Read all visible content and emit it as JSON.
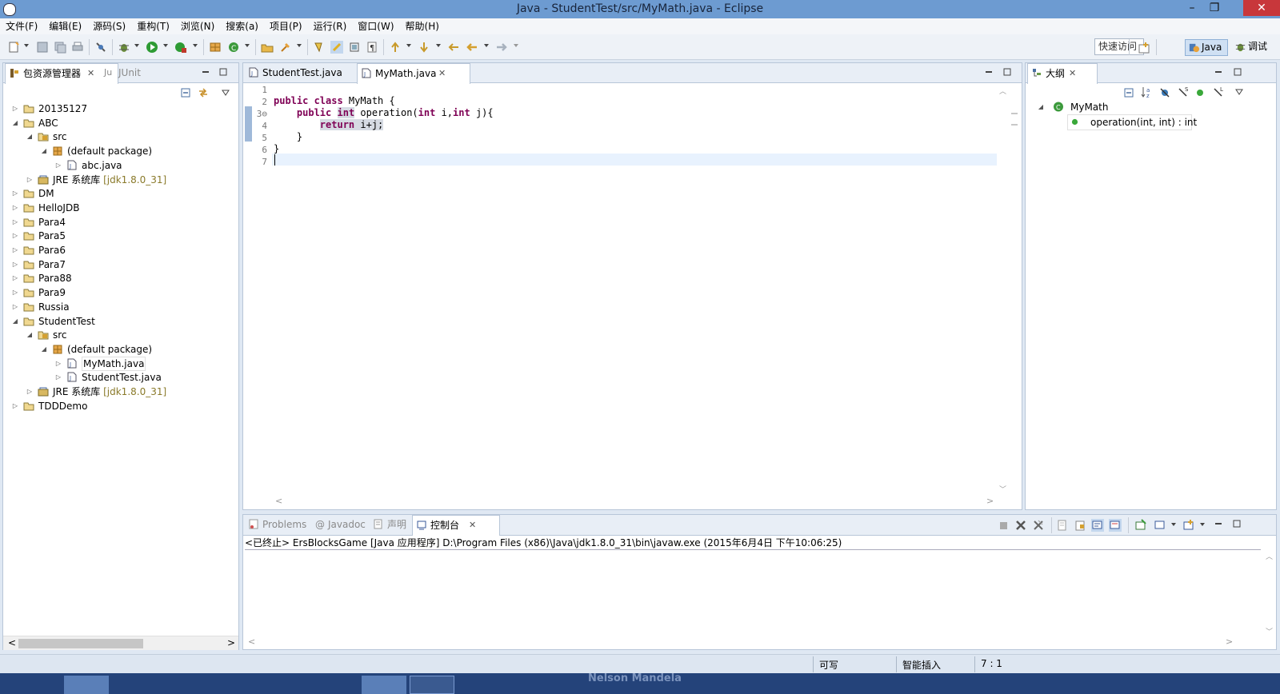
{
  "window": {
    "title": "Java - StudentTest/src/MyMath.java - Eclipse"
  },
  "menu": [
    "文件(F)",
    "编辑(E)",
    "源码(S)",
    "重构(T)",
    "浏览(N)",
    "搜索(a)",
    "项目(P)",
    "运行(R)",
    "窗口(W)",
    "帮助(H)"
  ],
  "toolbar": {
    "quick_access": "快速访问",
    "perspective_java": "Java",
    "perspective_debug": "调试"
  },
  "package_explorer": {
    "tab_label": "包资源管理器",
    "tab_junit": "JUnit",
    "tree": [
      {
        "label": "20135127",
        "depth": 0,
        "expanded": false,
        "icon": "project-icon"
      },
      {
        "label": "ABC",
        "depth": 0,
        "expanded": true,
        "icon": "project-icon"
      },
      {
        "label": "src",
        "depth": 1,
        "expanded": true,
        "icon": "source-folder-icon"
      },
      {
        "label": "(default package)",
        "depth": 2,
        "expanded": true,
        "icon": "package-icon"
      },
      {
        "label": "abc.java",
        "depth": 3,
        "expanded": false,
        "icon": "java-file-icon"
      },
      {
        "label": "JRE 系统库",
        "deco": "[jdk1.8.0_31]",
        "depth": 1,
        "expanded": false,
        "icon": "library-icon"
      },
      {
        "label": "DM",
        "depth": 0,
        "expanded": false,
        "icon": "project-icon"
      },
      {
        "label": "HelloJDB",
        "depth": 0,
        "expanded": false,
        "icon": "project-icon"
      },
      {
        "label": "Para4",
        "depth": 0,
        "expanded": false,
        "icon": "project-icon"
      },
      {
        "label": "Para5",
        "depth": 0,
        "expanded": false,
        "icon": "project-icon"
      },
      {
        "label": "Para6",
        "depth": 0,
        "expanded": false,
        "icon": "project-icon"
      },
      {
        "label": "Para7",
        "depth": 0,
        "expanded": false,
        "icon": "project-icon"
      },
      {
        "label": "Para88",
        "depth": 0,
        "expanded": false,
        "icon": "project-icon"
      },
      {
        "label": "Para9",
        "depth": 0,
        "expanded": false,
        "icon": "project-icon"
      },
      {
        "label": "Russia",
        "depth": 0,
        "expanded": false,
        "icon": "project-icon"
      },
      {
        "label": "StudentTest",
        "depth": 0,
        "expanded": true,
        "icon": "project-icon"
      },
      {
        "label": "src",
        "depth": 1,
        "expanded": true,
        "icon": "source-folder-icon"
      },
      {
        "label": "(default package)",
        "depth": 2,
        "expanded": true,
        "icon": "package-icon"
      },
      {
        "label": "MyMath.java",
        "depth": 3,
        "expanded": false,
        "icon": "java-file-icon",
        "selected": true
      },
      {
        "label": "StudentTest.java",
        "depth": 3,
        "expanded": false,
        "icon": "java-file-icon"
      },
      {
        "label": "JRE 系统库",
        "deco": "[jdk1.8.0_31]",
        "depth": 1,
        "expanded": false,
        "icon": "library-icon"
      },
      {
        "label": "TDDDemo",
        "depth": 0,
        "expanded": false,
        "icon": "project-icon"
      }
    ]
  },
  "editor": {
    "tabs": [
      {
        "label": "StudentTest.java",
        "active": false
      },
      {
        "label": "MyMath.java",
        "active": true
      }
    ],
    "line_numbers": [
      "1",
      "2",
      "3⊖",
      "4",
      "5",
      "6",
      "7"
    ],
    "cursor_line": 7
  },
  "outline": {
    "tab_label": "大纲",
    "class_name": "MyMath",
    "method": "operation(int, int) : int"
  },
  "console": {
    "tabs": [
      {
        "label": "Problems",
        "active": false
      },
      {
        "label": "Javadoc",
        "active": false
      },
      {
        "label": "声明",
        "active": false
      },
      {
        "label": "控制台",
        "active": true
      }
    ],
    "status_line": "<已终止> ErsBlocksGame [Java 应用程序] D:\\Program Files (x86)\\Java\\jdk1.8.0_31\\bin\\javaw.exe (2015年6月4日 下午10:06:25)"
  },
  "statusbar": {
    "writable": "可写",
    "insert_mode": "智能插入",
    "position": "7 : 1"
  },
  "taskbar": {
    "text": "Nelson Mandela"
  }
}
